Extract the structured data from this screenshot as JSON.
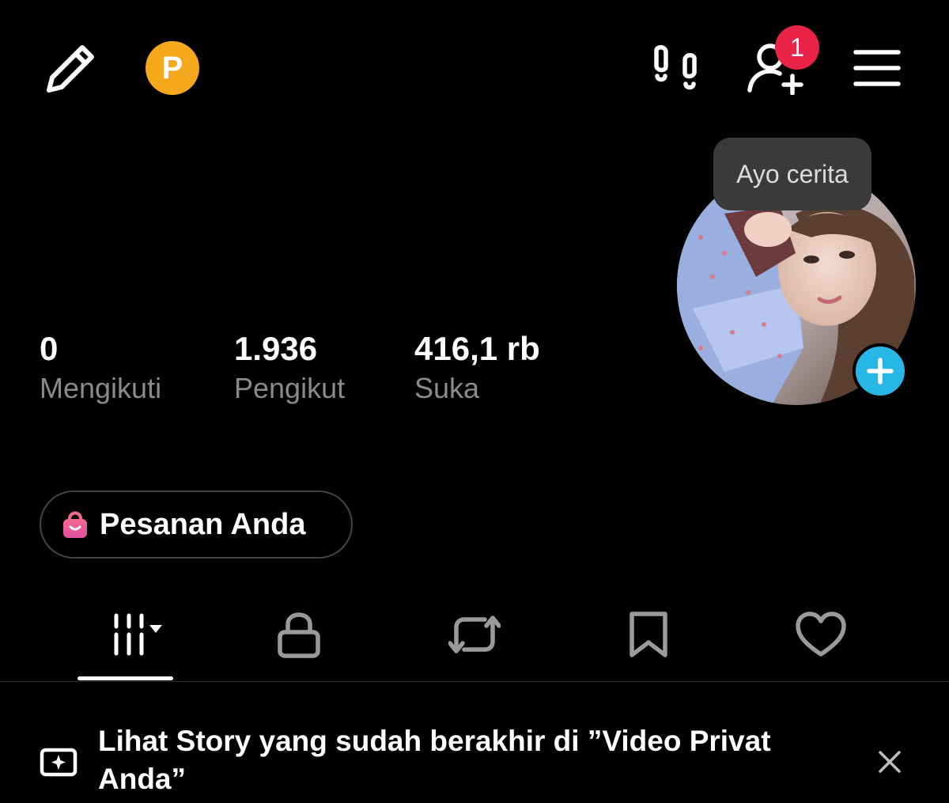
{
  "topbar": {
    "coin_letter": "P",
    "notification_count": "1"
  },
  "tooltip": {
    "text": "Ayo cerita"
  },
  "stats": [
    {
      "value": "0",
      "label": "Mengikuti"
    },
    {
      "value": "1.936",
      "label": "Pengikut"
    },
    {
      "value": "416,1 rb",
      "label": "Suka"
    }
  ],
  "orders": {
    "label": "Pesanan Anda"
  },
  "tabs": [
    {
      "name": "videos",
      "icon": "grid-bars-icon",
      "active": true
    },
    {
      "name": "private",
      "icon": "lock-icon"
    },
    {
      "name": "reposts",
      "icon": "repost-icon"
    },
    {
      "name": "saved",
      "icon": "bookmark-icon"
    },
    {
      "name": "liked",
      "icon": "heart-icon"
    }
  ],
  "banner": {
    "text": "Lihat Story yang sudah berakhir di ”Video Privat Anda”"
  },
  "colors": {
    "background": "#000000",
    "coin": "#f4a91c",
    "badge": "#ea2449",
    "add_button": "#28b6e6",
    "muted_text": "#8a8a8a",
    "orders_icon": "#ea4c89"
  }
}
